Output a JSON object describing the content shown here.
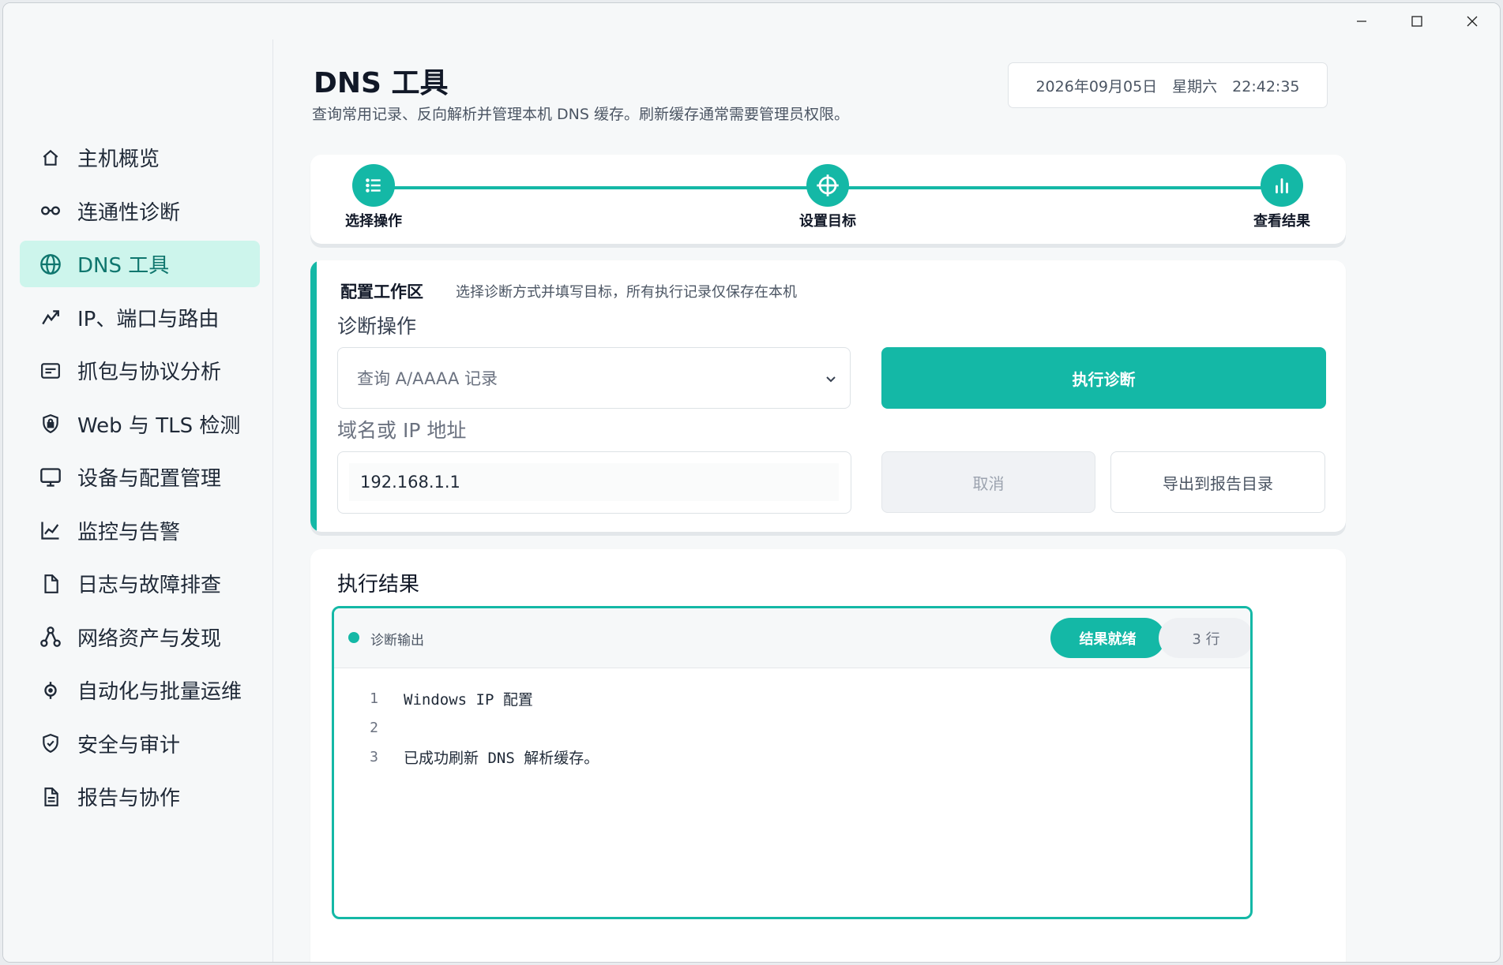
{
  "window": {
    "controls": [
      "minimize",
      "maximize",
      "close"
    ]
  },
  "sidebar": {
    "items": [
      {
        "label": "主机概览",
        "icon": "home-icon"
      },
      {
        "label": "连通性诊断",
        "icon": "link-icon"
      },
      {
        "label": "DNS 工具",
        "icon": "globe-icon",
        "active": true
      },
      {
        "label": "IP、端口与路由",
        "icon": "trend-icon"
      },
      {
        "label": "抓包与协议分析",
        "icon": "packet-icon"
      },
      {
        "label": "Web 与 TLS 检测",
        "icon": "shield-lock-icon"
      },
      {
        "label": "设备与配置管理",
        "icon": "monitor-icon"
      },
      {
        "label": "监控与告警",
        "icon": "line-chart-icon"
      },
      {
        "label": "日志与故障排查",
        "icon": "file-icon"
      },
      {
        "label": "网络资产与发现",
        "icon": "network-icon"
      },
      {
        "label": "自动化与批量运维",
        "icon": "target-icon"
      },
      {
        "label": "安全与审计",
        "icon": "shield-check-icon"
      },
      {
        "label": "报告与协作",
        "icon": "document-icon"
      }
    ]
  },
  "header": {
    "title": "DNS 工具",
    "subtitle": "查询常用记录、反向解析并管理本机 DNS 缓存。刷新缓存通常需要管理员权限。",
    "datetime": "2026年09月05日　星期六　22:42:35"
  },
  "stepper": {
    "steps": [
      "选择操作",
      "设置目标",
      "查看结果"
    ]
  },
  "config": {
    "title": "配置工作区",
    "hint": "选择诊断方式并填写目标，所有执行记录仅保存在本机",
    "operation_label": "诊断操作",
    "operation_value": "查询 A/AAAA 记录",
    "target_label": "域名或 IP 地址",
    "target_value": "192.168.1.1",
    "run_label": "执行诊断",
    "cancel_label": "取消",
    "export_label": "导出到报告目录"
  },
  "results": {
    "title": "执行结果",
    "output_title": "诊断输出",
    "status_badge": "结果就绪",
    "row_count": "3 行",
    "lines": [
      {
        "n": "1",
        "text": "Windows IP 配置"
      },
      {
        "n": "2",
        "text": ""
      },
      {
        "n": "3",
        "text": "已成功刷新 DNS 解析缓存。"
      }
    ]
  },
  "colors": {
    "accent": "#14b8a6",
    "active_nav_bg": "#cdf5ec",
    "active_nav_text": "#0f766e"
  }
}
